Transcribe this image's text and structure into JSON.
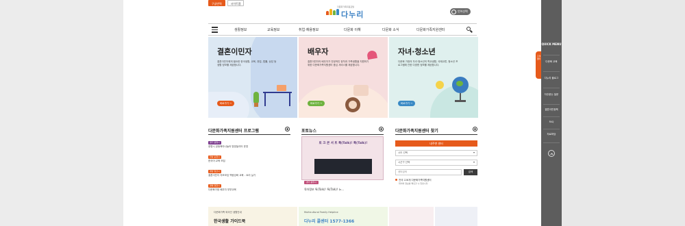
{
  "top_buttons": [
    "구글번역",
    "사이트맵"
  ],
  "logo": {
    "subtitle": "다문화가족지원포털",
    "name": "다누리"
  },
  "lang_button": "언어선택",
  "nav": {
    "items": [
      "생활정보",
      "교육정보",
      "취업·채용정보",
      "다문화 이해",
      "다문화 소식",
      "다문화가족지원센터"
    ]
  },
  "cards": [
    {
      "title": "결혼이민자",
      "desc": "결혼이민자에게 필요한 한국생활, 교육, 취업, 법률, 상담 등 생활 정보를 제공합니다.",
      "button": "바로가기 →",
      "bg": "#dce8f3",
      "btn_color": "#e65a1b"
    },
    {
      "title": "배우자",
      "desc": "결혼이민자의 배우자가 안정적인 정착과 가족생활을 지원하기 위한 다문화가족지원센터 중심 서비스를 제공합니다.",
      "button": "바로가기 →",
      "bg": "#f6dede",
      "btn_color": "#6fb33f"
    },
    {
      "title": "자녀·청소년",
      "desc": "다문화 가정의 자녀·청소년의 학교생활, 국제교류, 청소년 프로그램에 관한 다양한 정보를 제공합니다.",
      "button": "바로가기 →",
      "bg": "#dff0ee",
      "btn_color": "#3a8ac5"
    }
  ],
  "programs": {
    "title": "다문화가족지원센터 프로그램",
    "items": [
      {
        "badge": "경기 광명시",
        "text": "광명시 공동육아나눔터 방방놀이터 운영",
        "color": "#7a3a8c"
      },
      {
        "badge": "전남 순천시",
        "text": "한국어 교육 모집",
        "color": "#e65a1b"
      },
      {
        "badge": "경남 양산시",
        "text": "결혼이민자 자조모임 역량강화 교육 - 요리 실기",
        "color": "#e65a1b"
      },
      {
        "badge": "경북 영천시",
        "text": "다문화가정 배우자 부부교육",
        "color": "#e65a1b"
      }
    ]
  },
  "photo_news": {
    "title": "포토뉴스",
    "banner_text": "토 크 콘 서 트 톡(Talk)! 톡(Talk)!",
    "badge": "경기 광주시",
    "caption": "육아정보 톡(Talk)! 톡(Talk)! 뉴..."
  },
  "center_find": {
    "title": "다문화가족지원센터 찾기",
    "header": "내주변 센터",
    "select_sido": "시도 선택",
    "select_sigungu": "시군구 선택",
    "input_placeholder": "센터검색",
    "search_button": "검색",
    "note": "전국 228개 다문화가족지원센터",
    "note2": "위치와 정보를 확인할 수 있습니다."
  },
  "banners": [
    {
      "top": "다문화가족·외국인 생활안내",
      "bottom": "한국생활 가이드북",
      "bg": "#f8f3e4"
    },
    {
      "top": "Multicultural Family Helpline",
      "bottom": "다누리 콜센터 1577-1366",
      "bg": "#f0f7e6"
    },
    {
      "top": "",
      "bottom": "",
      "bg": "#f8eef0"
    },
    {
      "top": "",
      "bottom": "",
      "bg": "#eef0f6"
    }
  ],
  "quick_menu": {
    "title": "QUICK MENU",
    "tab": "고객센터",
    "items": [
      "다문화 교육",
      "다누리 블로그",
      "자주묻는 질문",
      "결혼이민정책",
      "FAQ",
      "자료마당"
    ]
  }
}
